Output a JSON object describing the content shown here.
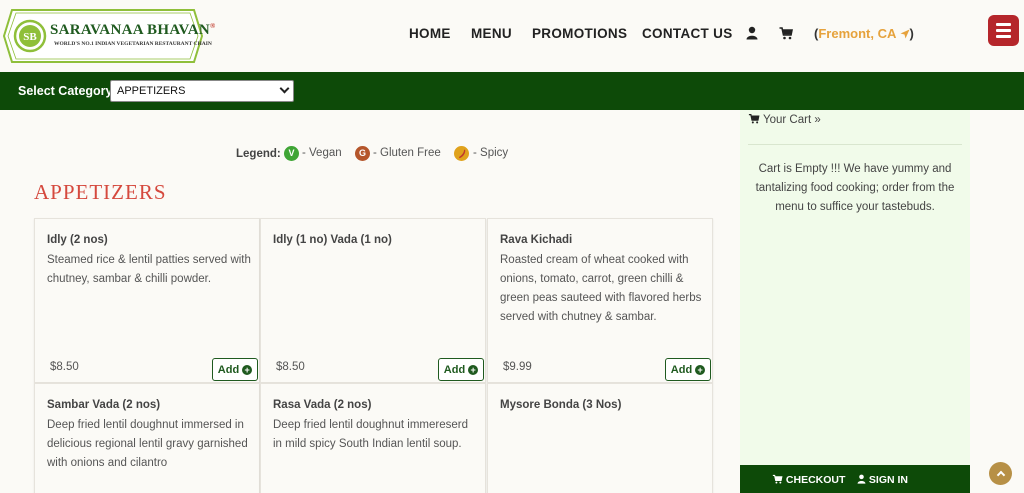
{
  "brand": {
    "name": "SARAVANAA BHAVAN",
    "registered": "®",
    "tagline": "WORLD'S NO.1 INDIAN VEGETARIAN RESTAURANT CHAIN",
    "logo_color": "#1f5a1f"
  },
  "nav": {
    "home": "HOME",
    "menu": "MENU",
    "promotions": "PROMOTIONS",
    "contact": "CONTACT US",
    "user_icon": "user-icon",
    "cart_icon": "cart-icon",
    "location_open": "(",
    "location_city": "Fremont, CA",
    "location_close": ")",
    "location_icon": "location-arrow-icon"
  },
  "category_bar": {
    "label": "Select Category",
    "selected": "APPETIZERS"
  },
  "legend": {
    "title": "Legend:",
    "vegan": "- Vegan",
    "gluten_free": "- Gluten Free",
    "spicy": "- Spicy",
    "vegan_glyph": "V",
    "gluten_glyph": "G",
    "spicy_glyph": "🌶"
  },
  "section_title": "APPETIZERS",
  "items": [
    {
      "name": "Idly (2 nos)",
      "desc": "Steamed rice & lentil patties served with chutney, sambar & chilli powder.",
      "price": "$8.50",
      "add": "Add"
    },
    {
      "name": "Idly (1 no) Vada (1 no)",
      "desc": "",
      "price": "$8.50",
      "add": "Add"
    },
    {
      "name": "Rava Kichadi",
      "desc": "Roasted cream of wheat cooked with onions, tomato, carrot, green chilli & green peas sauteed with flavored herbs served with chutney & sambar.",
      "price": "$9.99",
      "add": "Add"
    },
    {
      "name": "Sambar Vada (2 nos)",
      "desc": "Deep fried lentil doughnut immersed in delicious regional lentil gravy garnished with onions and cilantro",
      "price": "",
      "add": ""
    },
    {
      "name": "Rasa Vada (2 nos)",
      "desc": "Deep fried lentil doughnut immereserd in mild spicy South Indian lentil soup.",
      "price": "",
      "add": ""
    },
    {
      "name": "Mysore Bonda (3 Nos)",
      "desc": "",
      "price": "",
      "add": ""
    }
  ],
  "cart": {
    "heading": "Your Cart »",
    "empty_message": "Cart is Empty !!! We have yummy and tantalizing food cooking; order from the menu to suffice your tastebuds.",
    "checkout": "CHECKOUT",
    "sign_in": "SIGN IN"
  },
  "colors": {
    "dark_green": "#0d4a08",
    "accent_red": "#b5262b",
    "title_red": "#d5493e",
    "location_orange": "#e6a23c",
    "vegan": "#3fa535",
    "gluten": "#b5562b",
    "spicy": "#e0a21c"
  }
}
